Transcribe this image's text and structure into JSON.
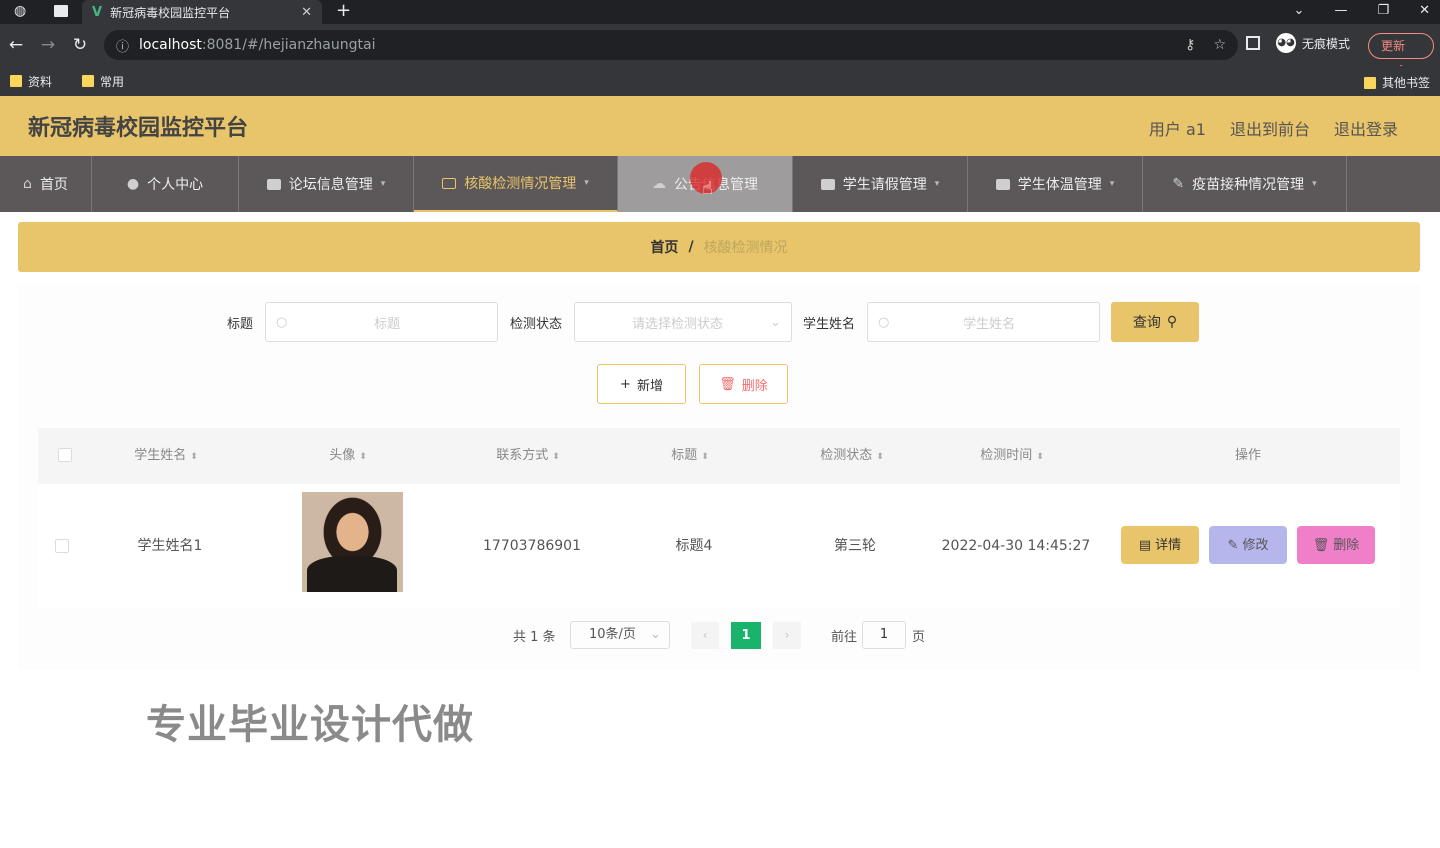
{
  "browser": {
    "tab_title": "新冠病毒校园监控平台",
    "tab_close": "✕",
    "new_tab": "+",
    "url_host": "localhost",
    "url_path": ":8081/#/hejianzhaungtai",
    "profile_label": "无痕模式",
    "update_label": "更新",
    "bookmarks": [
      "资料",
      "常用"
    ],
    "other_bookmarks": "其他书签"
  },
  "header": {
    "title": "新冠病毒校园监控平台",
    "user": "用户 a1",
    "back_front": "退出到前台",
    "logout": "退出登录"
  },
  "nav": {
    "items": [
      "首页",
      "个人中心",
      "论坛信息管理",
      "核酸检测情况管理",
      "公告信息管理",
      "学生请假管理",
      "学生体温管理",
      "疫苗接种情况管理"
    ]
  },
  "breadcrumb": {
    "home": "首页",
    "sep": "/",
    "current": "核酸检测情况"
  },
  "search": {
    "title_label": "标题",
    "title_placeholder": "标题",
    "status_label": "检测状态",
    "status_placeholder": "请选择检测状态",
    "name_label": "学生姓名",
    "name_placeholder": "学生姓名",
    "query_label": "查询"
  },
  "actions": {
    "add_label": "新增",
    "delete_label": "删除"
  },
  "table": {
    "headers": [
      "学生姓名",
      "头像",
      "联系方式",
      "标题",
      "检测状态",
      "检测时间",
      "操作"
    ],
    "rows": [
      {
        "name": "学生姓名1",
        "phone": "17703786901",
        "title": "标题4",
        "status": "第三轮",
        "time": "2022-04-30 14:45:27",
        "detail_label": "详情",
        "edit_label": "修改",
        "delete_label": "删除"
      }
    ]
  },
  "pager": {
    "total": "共 1 条",
    "page_size": "10条/页",
    "current": "1",
    "goto_label": "前往",
    "goto_value": "1",
    "page_suffix": "页"
  },
  "watermark": "专业毕业设计代做",
  "colors": {
    "accent": "#e8c46a",
    "nav_bg": "#5c5859",
    "pager_active": "#19b36b",
    "edit_btn": "#b6b6ec",
    "delete_btn": "#f07fca"
  }
}
